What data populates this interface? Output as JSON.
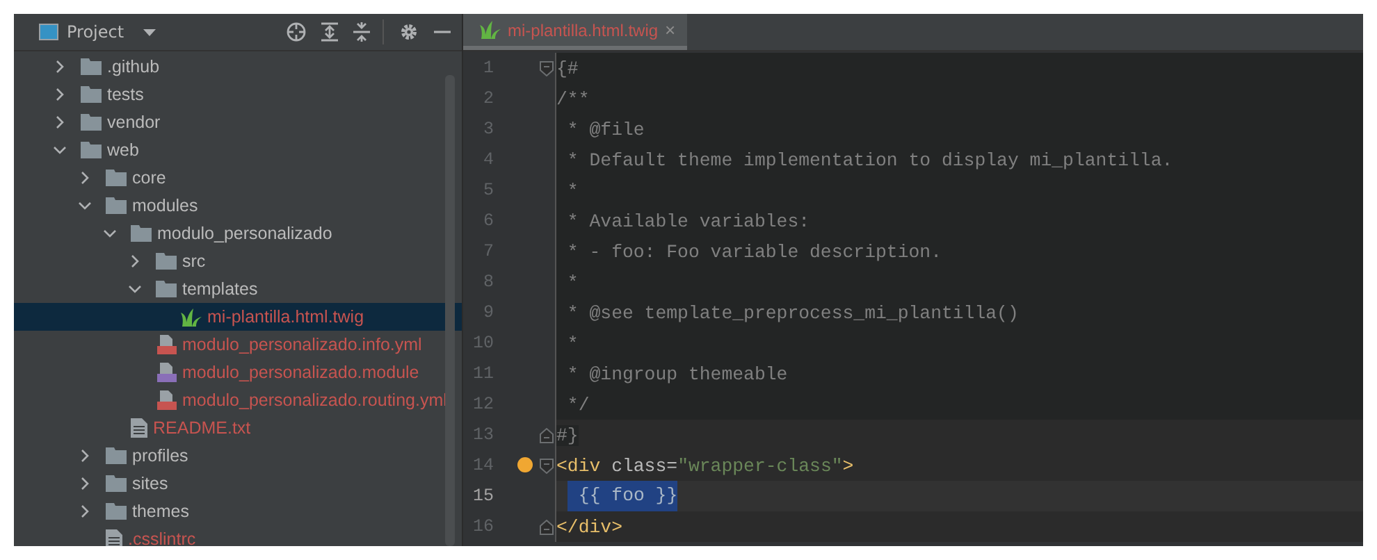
{
  "project_panel": {
    "title": "Project",
    "tree": [
      {
        "name": ".github",
        "kind": "folder",
        "expanded": false,
        "selected": false
      },
      {
        "name": "tests",
        "kind": "folder",
        "expanded": false,
        "selected": false
      },
      {
        "name": "vendor",
        "kind": "folder",
        "expanded": false,
        "selected": false
      },
      {
        "name": "web",
        "kind": "folder",
        "expanded": true,
        "selected": false,
        "children": [
          {
            "name": "core",
            "kind": "folder",
            "expanded": false,
            "selected": false
          },
          {
            "name": "modules",
            "kind": "folder",
            "expanded": true,
            "selected": false,
            "children": [
              {
                "name": "modulo_personalizado",
                "kind": "folder",
                "expanded": true,
                "selected": false,
                "children": [
                  {
                    "name": "src",
                    "kind": "folder",
                    "expanded": false,
                    "selected": false
                  },
                  {
                    "name": "templates",
                    "kind": "folder",
                    "expanded": true,
                    "selected": false,
                    "children": [
                      {
                        "name": "mi-plantilla.html.twig",
                        "kind": "twig",
                        "selected": true,
                        "color": "#c75450"
                      }
                    ]
                  },
                  {
                    "name": "modulo_personalizado.info.yml",
                    "kind": "yml",
                    "selected": false,
                    "color": "#c75450"
                  },
                  {
                    "name": "modulo_personalizado.module",
                    "kind": "php",
                    "selected": false,
                    "color": "#c75450"
                  },
                  {
                    "name": "modulo_personalizado.routing.yml",
                    "kind": "yml",
                    "selected": false,
                    "color": "#c75450"
                  }
                ]
              },
              {
                "name": "README.txt",
                "kind": "text",
                "selected": false,
                "color": "#c75450"
              }
            ]
          },
          {
            "name": "profiles",
            "kind": "folder",
            "expanded": false,
            "selected": false
          },
          {
            "name": "sites",
            "kind": "folder",
            "expanded": false,
            "selected": false
          },
          {
            "name": "themes",
            "kind": "folder",
            "expanded": false,
            "selected": false
          },
          {
            "name": ".csslintrc",
            "kind": "text",
            "selected": false,
            "color": "#c75450"
          }
        ]
      }
    ]
  },
  "editor": {
    "tabs": [
      {
        "label": "mi-plantilla.html.twig",
        "selected": true,
        "close": "×"
      }
    ],
    "lines": [
      {
        "number": "1",
        "fold_start": true,
        "shaded": true,
        "segments": [
          {
            "text": "{#",
            "kind": "comment"
          }
        ]
      },
      {
        "number": "2",
        "shaded": true,
        "segments": [
          {
            "text": "/**",
            "kind": "comment"
          }
        ]
      },
      {
        "number": "3",
        "shaded": true,
        "segments": [
          {
            "text": " * @file",
            "kind": "comment"
          }
        ]
      },
      {
        "number": "4",
        "shaded": true,
        "segments": [
          {
            "text": " * Default theme implementation to display mi_plantilla.",
            "kind": "comment"
          }
        ]
      },
      {
        "number": "5",
        "shaded": true,
        "segments": [
          {
            "text": " *",
            "kind": "comment"
          }
        ]
      },
      {
        "number": "6",
        "shaded": true,
        "segments": [
          {
            "text": " * Available variables:",
            "kind": "comment"
          }
        ]
      },
      {
        "number": "7",
        "shaded": true,
        "segments": [
          {
            "text": " * - foo: Foo variable description.",
            "kind": "comment"
          }
        ]
      },
      {
        "number": "8",
        "shaded": true,
        "segments": [
          {
            "text": " *",
            "kind": "comment"
          }
        ]
      },
      {
        "number": "9",
        "shaded": true,
        "segments": [
          {
            "text": " * @see template_preprocess_mi_plantilla()",
            "kind": "comment"
          }
        ]
      },
      {
        "number": "10",
        "shaded": true,
        "segments": [
          {
            "text": " *",
            "kind": "comment"
          }
        ]
      },
      {
        "number": "11",
        "shaded": true,
        "segments": [
          {
            "text": " * @ingroup themeable",
            "kind": "comment"
          }
        ]
      },
      {
        "number": "12",
        "shaded": true,
        "segments": [
          {
            "text": " */",
            "kind": "comment"
          }
        ]
      },
      {
        "number": "13",
        "fold_end": true,
        "segments": [
          {
            "text": "#}",
            "kind": "comment-shaded"
          }
        ]
      },
      {
        "number": "14",
        "fold_start": true,
        "bulb": true,
        "segments": [
          {
            "text": "<div",
            "kind": "tag"
          },
          {
            "text": " class=",
            "kind": "attr"
          },
          {
            "text": "\"wrapper-class\"",
            "kind": "string"
          },
          {
            "text": ">",
            "kind": "tag"
          }
        ]
      },
      {
        "number": "15",
        "current": true,
        "segments": [
          {
            "text": " {{ foo }}",
            "kind": "plain",
            "selected": true
          }
        ]
      },
      {
        "number": "16",
        "fold_end": true,
        "segments": [
          {
            "text": "</div>",
            "kind": "tag"
          }
        ]
      }
    ]
  }
}
